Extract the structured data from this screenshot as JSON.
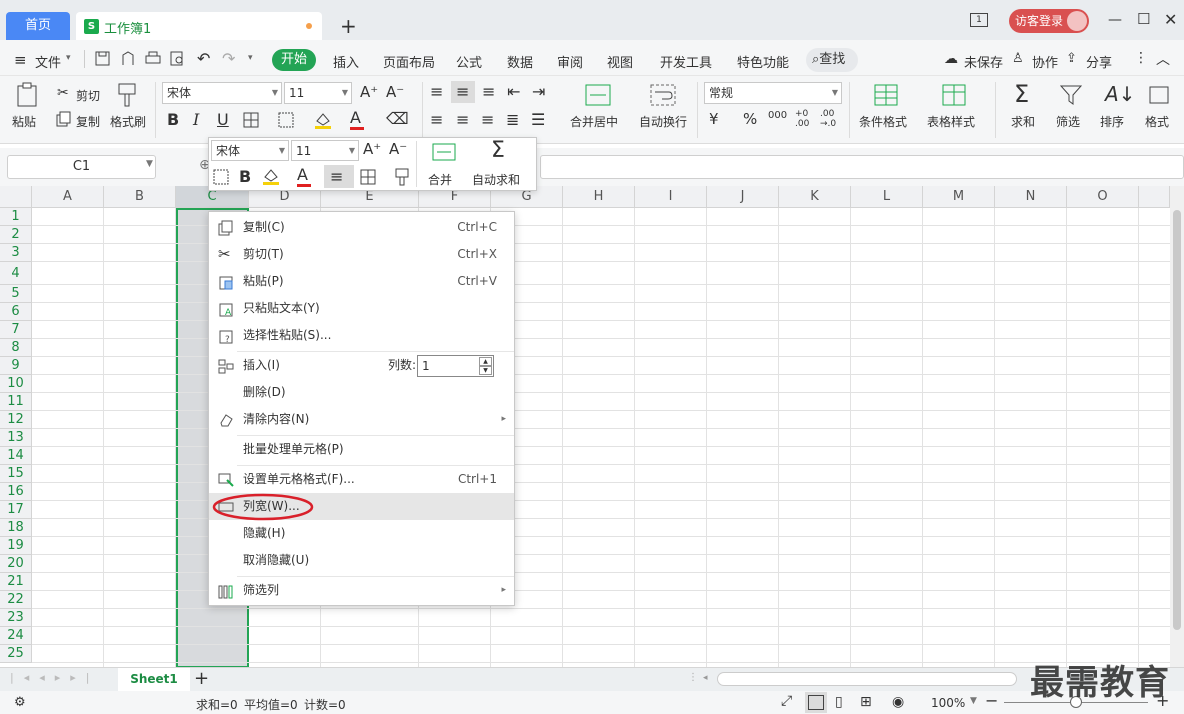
{
  "tabs": {
    "home": "首页",
    "workbook": "工作簿1",
    "workbook_icon": "S",
    "new": "+"
  },
  "window": {
    "login": "访客登录"
  },
  "menu": {
    "file": "文件",
    "items": [
      "开始",
      "插入",
      "页面布局",
      "公式",
      "数据",
      "审阅",
      "视图",
      "开发工具",
      "特色功能"
    ],
    "search": "查找",
    "unsaved": "未保存",
    "collab": "协作",
    "share": "分享"
  },
  "ribbon": {
    "paste": "粘贴",
    "cut": "剪切",
    "copy": "复制",
    "format_painter": "格式刷",
    "font": "宋体",
    "size": "11",
    "number_format": "常规",
    "merge": "合并居中",
    "wrap": "自动换行",
    "cond_format": "条件格式",
    "table_style": "表格样式",
    "sum": "求和",
    "filter": "筛选",
    "sort": "排序",
    "format": "格式"
  },
  "formula": {
    "namebox": "C1"
  },
  "grid": {
    "columns": [
      "A",
      "B",
      "C",
      "D",
      "E",
      "F",
      "G",
      "H",
      "I",
      "J",
      "K",
      "L",
      "M",
      "N",
      "O"
    ],
    "rows": [
      "1",
      "2",
      "3",
      "4",
      "5",
      "6",
      "7",
      "8",
      "9",
      "10",
      "11",
      "12",
      "13",
      "14",
      "15",
      "16",
      "17",
      "18",
      "19",
      "20",
      "21",
      "22",
      "23",
      "24",
      "25"
    ]
  },
  "minitoolbar": {
    "font": "宋体",
    "size": "11",
    "merge": "合并",
    "autosum": "自动求和"
  },
  "context_menu": {
    "copy": "复制(C)",
    "copy_sc": "Ctrl+C",
    "cut": "剪切(T)",
    "cut_sc": "Ctrl+X",
    "paste": "粘贴(P)",
    "paste_sc": "Ctrl+V",
    "paste_text": "只粘贴文本(Y)",
    "paste_special": "选择性粘贴(S)...",
    "insert": "插入(I)",
    "insert_cols_label": "列数:",
    "insert_cols_value": "1",
    "delete": "删除(D)",
    "clear": "清除内容(N)",
    "batch": "批量处理单元格(P)",
    "format_cells": "设置单元格格式(F)...",
    "format_cells_sc": "Ctrl+1",
    "col_width": "列宽(W)...",
    "hide": "隐藏(H)",
    "unhide": "取消隐藏(U)",
    "filter_col": "筛选列"
  },
  "sheets": {
    "active": "Sheet1"
  },
  "status": {
    "sum": "求和=0",
    "avg": "平均值=0",
    "count": "计数=0",
    "zoom": "100%"
  },
  "watermark": "最需教育",
  "colors": {
    "accent": "#23a455",
    "home_tab": "#4a88f5",
    "login": "#d95050",
    "annotation": "#d9202a"
  }
}
